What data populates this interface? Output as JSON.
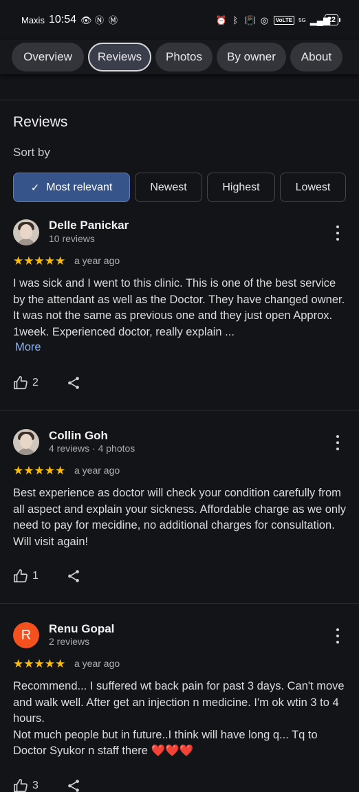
{
  "status_bar": {
    "carrier": "Maxis",
    "time": "10:54",
    "network": "5G",
    "volte": "VoLTE",
    "battery": "22"
  },
  "tabs": [
    {
      "label": "Overview",
      "active": false
    },
    {
      "label": "Reviews",
      "active": true
    },
    {
      "label": "Photos",
      "active": false
    },
    {
      "label": "By owner",
      "active": false
    },
    {
      "label": "About",
      "active": false
    }
  ],
  "section": {
    "title": "Reviews",
    "sort_label": "Sort by"
  },
  "sort_chips": [
    {
      "label": "Most relevant",
      "selected": true
    },
    {
      "label": "Newest",
      "selected": false
    },
    {
      "label": "Highest",
      "selected": false
    },
    {
      "label": "Lowest",
      "selected": false
    }
  ],
  "reviews": [
    {
      "name": "Delle Panickar",
      "meta": "10 reviews",
      "avatar": "photo",
      "rating": 5,
      "stars": "★★★★★",
      "when": "a year ago",
      "text": "I was sick and I went to this clinic. This is one of the best service by the attendant as well as the Doctor. They have changed owner. It was not the same as previous one and they just open Approx. 1week. Experienced doctor, really explain ...",
      "more_label": "More",
      "likes": "2"
    },
    {
      "name": "Collin Goh",
      "meta": "4 reviews · 4 photos",
      "avatar": "photo",
      "rating": 5,
      "stars": "★★★★★",
      "when": "a year ago",
      "text": "Best experience as doctor will check your condition carefully from all aspect and explain your sickness. Affordable charge as we only need to pay for mecidine, no additional charges for consultation. Will visit again!",
      "likes": "1"
    },
    {
      "name": "Renu Gopal",
      "meta": "2 reviews",
      "avatar": "letter",
      "avatar_letter": "R",
      "avatar_color": "#f4511e",
      "rating": 5,
      "stars": "★★★★★",
      "when": "a year ago",
      "text": "Recommend... I suffered wt back pain for past 3 days. Can't move and walk well. After get an injection n medicine. I'm ok wtin 3 to 4 hours.\nNot much people but in future..I think will have long q... Tq to Doctor Syukor n staff there",
      "text_emoji": "❤️❤️❤️",
      "likes": "3"
    }
  ],
  "colors": {
    "background": "#131418",
    "accent_chip": "#36548a",
    "star": "#fbbc04",
    "link": "#8ab4f8"
  }
}
